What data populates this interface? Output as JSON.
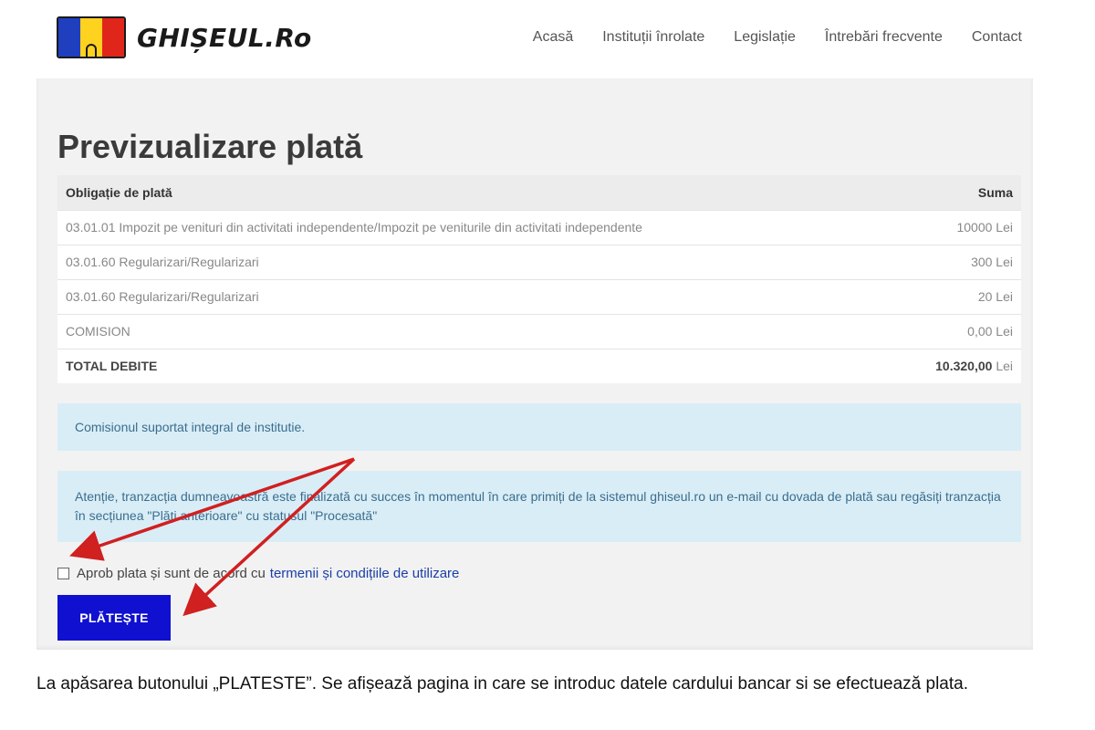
{
  "header": {
    "logo_text": "GHIȘEUL.Ro",
    "nav": [
      "Acasă",
      "Instituții înrolate",
      "Legislație",
      "Întrebări frecvente",
      "Contact"
    ]
  },
  "page": {
    "title": "Previzualizare plată"
  },
  "table": {
    "headers": [
      "Obligație de plată",
      "Suma"
    ],
    "rows": [
      {
        "label": "03.01.01 Impozit pe venituri din activitati independente/Impozit pe veniturile din activitati independente",
        "amount": "10000 Lei"
      },
      {
        "label": "03.01.60 Regularizari/Regularizari",
        "amount": "300 Lei"
      },
      {
        "label": "03.01.60 Regularizari/Regularizari",
        "amount": "20 Lei"
      },
      {
        "label": "COMISION",
        "amount": "0,00 Lei"
      }
    ],
    "total": {
      "label": "TOTAL DEBITE",
      "value": "10.320,00",
      "unit": "Lei"
    }
  },
  "alerts": {
    "commission": "Comisionul suportat integral de institutie.",
    "warning": "Atenție, tranzacția dumneavoastră este finalizată cu succes în momentul în care primiți de la sistemul ghiseul.ro un e-mail cu dovada de plată sau regăsiți tranzacția în secțiunea \"Plăți anterioare\" cu statusul \"Procesată\""
  },
  "agreement": {
    "text": "Aprob plata și sunt de acord cu",
    "link": "termenii și condițiile de utilizare",
    "checked": false
  },
  "pay_button": "PLĂTEȘTE",
  "caption": "La apăsarea butonului „PLATESTE”. Se afișează pagina in care se introduc datele cardului bancar si se efectuează plata.",
  "colors": {
    "accent_button": "#1010d0",
    "alert_bg": "#d9edf7",
    "arrow": "#d02020",
    "link": "#1a3ea8"
  }
}
